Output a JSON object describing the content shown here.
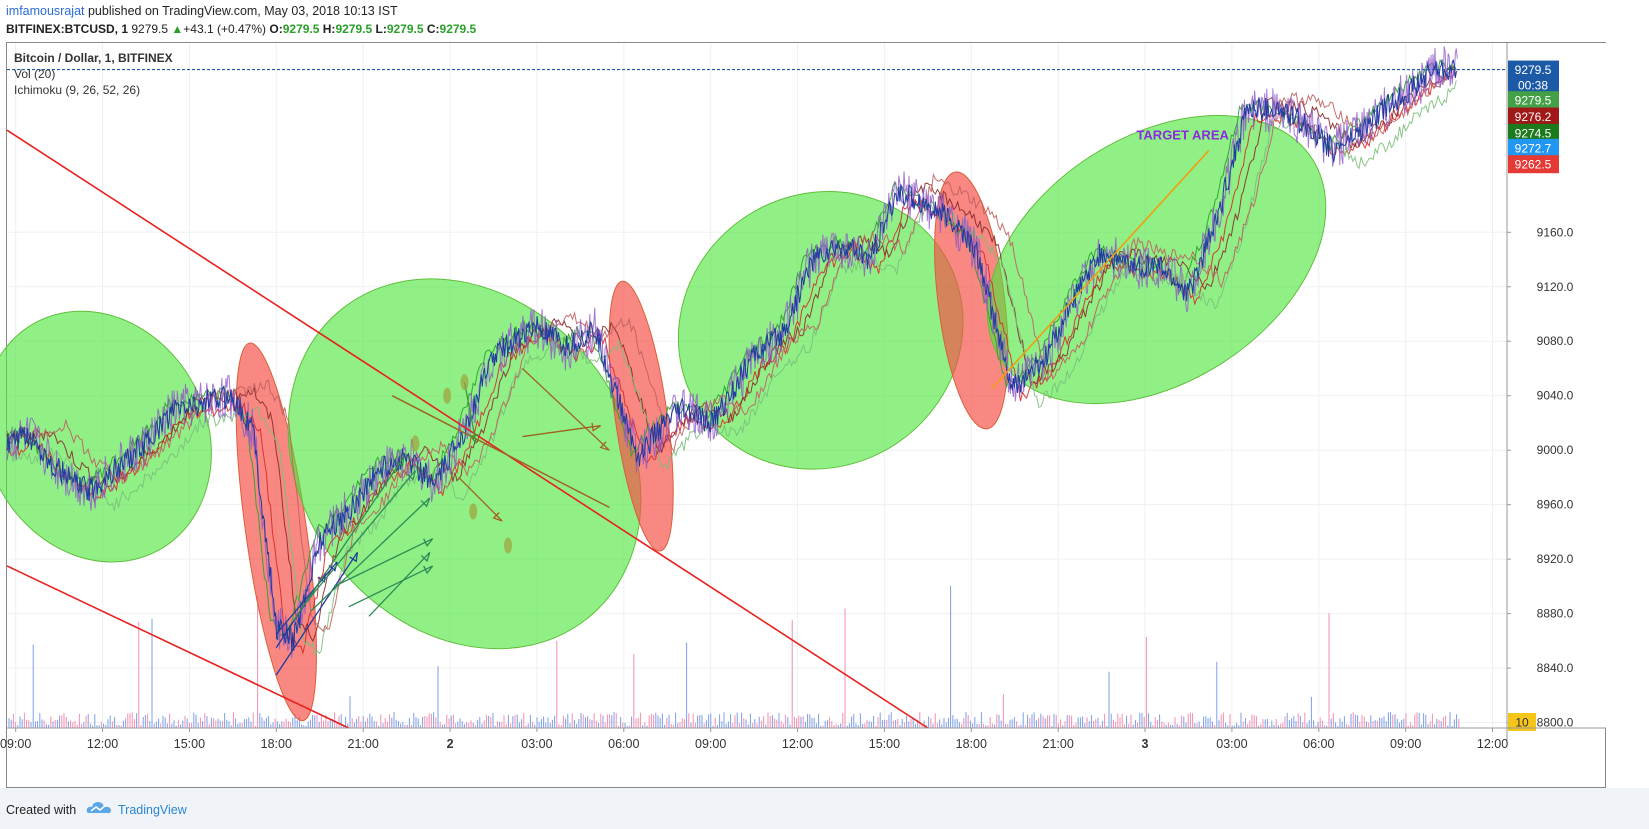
{
  "header": {
    "author": "imfamousrajat",
    "published_text": "published on TradingView.com, May 03, 2018 10:13 IST",
    "symbol": "BITFINEX:BTCUSD, 1",
    "last": "9279.5",
    "change_arrow": "▲",
    "change": "+43.1 (+0.47%)",
    "o_label": "O:",
    "o": "9279.5",
    "h_label": "H:",
    "h": "9279.5",
    "l_label": "L:",
    "l": "9279.5",
    "c_label": "C:",
    "c": "9279.5"
  },
  "legend": {
    "title": "Bitcoin / Dollar, 1, BITFINEX",
    "vol": "Vol (20)",
    "ichimoku": "Ichimoku (9, 26, 52, 26)"
  },
  "footer": {
    "created_with": "Created with",
    "brand": "TradingView",
    "logo_icon": "tradingview-cloud-icon"
  },
  "chart_data": {
    "type": "line",
    "title": "Bitcoin / Dollar, 1, BITFINEX",
    "x_ticks": [
      "09:00",
      "12:00",
      "15:00",
      "18:00",
      "21:00",
      "2",
      "03:00",
      "06:00",
      "09:00",
      "12:00",
      "15:00",
      "18:00",
      "21:00",
      "3",
      "03:00",
      "06:00",
      "09:00",
      "12:00"
    ],
    "x_tick_idx": [
      0,
      3,
      6,
      9,
      12,
      15,
      18,
      21,
      24,
      27,
      30,
      33,
      36,
      39,
      42,
      45,
      48,
      51
    ],
    "x_range": [
      -0.3,
      51.5
    ],
    "y_ticks": [
      "8800.0",
      "8840.0",
      "8880.0",
      "8920.0",
      "8960.0",
      "9000.0",
      "9040.0",
      "9080.0",
      "9120.0",
      "9160.0"
    ],
    "ylim": [
      8796,
      9299
    ],
    "grid": true,
    "price_series": {
      "name": "BTCUSD",
      "x": [
        -0.3,
        0.5,
        1.5,
        2.5,
        3.4,
        4.5,
        5.5,
        6.5,
        7.5,
        8.2,
        9.0,
        9.6,
        10.5,
        11.5,
        12.5,
        13.5,
        14.5,
        15.5,
        16.5,
        17.5,
        18.0,
        19.0,
        20.0,
        20.6,
        21.5,
        22.2,
        23.0,
        24.0,
        24.5,
        25.5,
        26.5,
        27.5,
        28.5,
        29.5,
        30.5,
        31.5,
        32.5,
        33.2,
        33.8,
        34.4,
        35.5,
        36.5,
        37.5,
        38.5,
        39.5,
        40.5,
        41.5,
        42.5,
        43.5,
        44.5,
        45.5,
        46.5,
        47.5,
        48.5,
        49.0,
        49.8
      ],
      "y": [
        9005,
        9010,
        8985,
        8970,
        8985,
        9005,
        9030,
        9035,
        9040,
        9015,
        8870,
        8860,
        8935,
        8955,
        8985,
        8995,
        8975,
        9015,
        9070,
        9085,
        9090,
        9075,
        9088,
        9050,
        8995,
        9015,
        9030,
        9020,
        9035,
        9070,
        9085,
        9140,
        9150,
        9140,
        9190,
        9180,
        9165,
        9145,
        9095,
        9045,
        9065,
        9110,
        9145,
        9135,
        9135,
        9115,
        9170,
        9250,
        9250,
        9240,
        9220,
        9235,
        9255,
        9270,
        9280,
        9279.5
      ],
      "color": "#1f3b9e"
    },
    "ichimoku_lines": [
      {
        "name": "Tenkan",
        "color": "#d62a2a",
        "offset": 0.3,
        "dy": -6
      },
      {
        "name": "Kijun",
        "color": "#8b2a2a",
        "offset": 0.7,
        "dy": 4
      },
      {
        "name": "Chikou",
        "color": "#2aa02a",
        "offset": -0.2,
        "dy": 3
      },
      {
        "name": "Span A",
        "color": "#7bbf7b",
        "offset": 0.9,
        "dy": -10
      },
      {
        "name": "Span B",
        "color": "#c06060",
        "offset": 1.2,
        "dy": 8
      }
    ],
    "price_labels": [
      {
        "value": "9279.5",
        "bg": "#1c5aa8",
        "y": 9279.5
      },
      {
        "value": "00:38",
        "bg": "#1c5aa8",
        "y": 9268
      },
      {
        "value": "9279.5",
        "bg": "#43a047",
        "y": 9257
      },
      {
        "value": "9276.2",
        "bg": "#a01818",
        "y": 9245
      },
      {
        "value": "9274.5",
        "bg": "#1b7a1b",
        "y": 9233
      },
      {
        "value": "9272.7",
        "bg": "#2196f3",
        "y": 9222
      },
      {
        "value": "9262.5",
        "bg": "#e53935",
        "y": 9210
      }
    ],
    "volume_badge": "10",
    "annotations": [
      {
        "text": "TARGET AREA",
        "x": 40.3,
        "y": 9228,
        "color": "#8a2be2"
      }
    ],
    "ellipses": [
      {
        "name": "green-zone-1",
        "color": "green",
        "cx": 2.8,
        "cy": 9010,
        "rx": 3.8,
        "ry": 95,
        "rot": -28
      },
      {
        "name": "red-zone-1",
        "color": "red",
        "cx": 9.0,
        "cy": 8940,
        "rx": 1.05,
        "ry": 140,
        "rot": -8
      },
      {
        "name": "green-zone-2",
        "color": "green",
        "cx": 15.5,
        "cy": 8990,
        "rx": 5.6,
        "ry": 145,
        "rot": -38
      },
      {
        "name": "red-zone-2",
        "color": "red",
        "cx": 21.6,
        "cy": 9025,
        "rx": 0.9,
        "ry": 100,
        "rot": -8
      },
      {
        "name": "green-zone-3",
        "color": "green",
        "cx": 27.8,
        "cy": 9088,
        "rx": 5.0,
        "ry": 100,
        "rot": -33
      },
      {
        "name": "red-zone-3",
        "color": "red",
        "cx": 33.0,
        "cy": 9110,
        "rx": 1.15,
        "ry": 95,
        "rot": -7
      },
      {
        "name": "green-zone-4",
        "color": "green",
        "cx": 39.4,
        "cy": 9140,
        "rx": 6.4,
        "ry": 90,
        "rot": -33
      }
    ],
    "trend_lines": [
      {
        "name": "upper-red-trendline",
        "color": "#e8201e",
        "x1": -0.3,
        "y1": 9235,
        "x2": 31.5,
        "y2": 8796
      },
      {
        "name": "lower-red-trendline",
        "color": "#e8201e",
        "x1": -0.3,
        "y1": 8915,
        "x2": 11.5,
        "y2": 8796
      },
      {
        "name": "brown-trendline",
        "color": "#a0621e",
        "x1": 13.0,
        "y1": 9040,
        "x2": 20.5,
        "y2": 8958
      },
      {
        "name": "orange-target-line",
        "color": "#f39c12",
        "x1": 33.7,
        "y1": 9045,
        "x2": 41.2,
        "y2": 9220
      }
    ]
  }
}
